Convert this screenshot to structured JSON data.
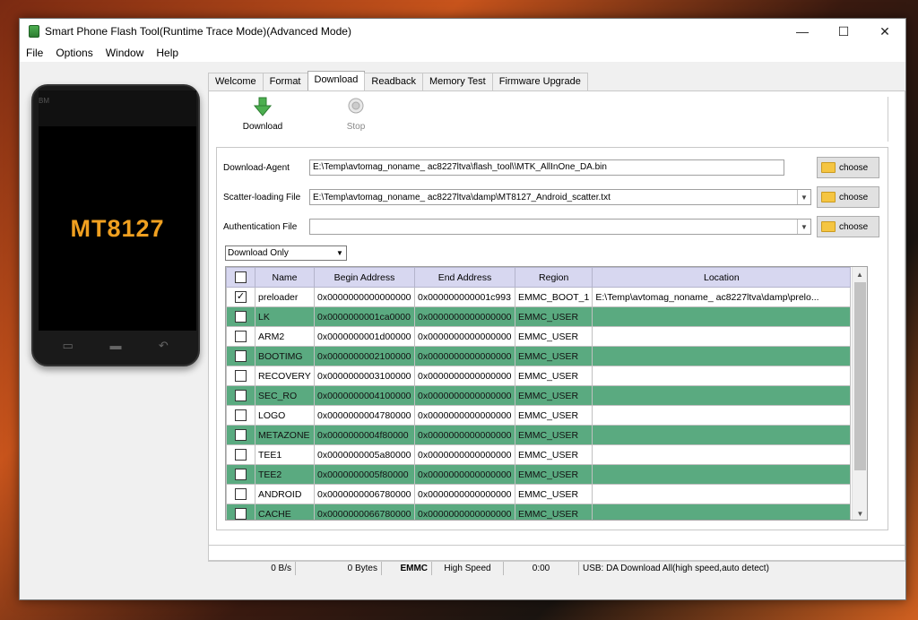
{
  "window": {
    "title": "Smart Phone Flash Tool(Runtime Trace Mode)(Advanced Mode)"
  },
  "menu": [
    "File",
    "Options",
    "Window",
    "Help"
  ],
  "phone": {
    "brand": "BM",
    "chip": "MT8127"
  },
  "tabs": [
    "Welcome",
    "Format",
    "Download",
    "Readback",
    "Memory Test",
    "Firmware Upgrade"
  ],
  "active_tab": "Download",
  "toolbar": {
    "download_label": "Download",
    "stop_label": "Stop"
  },
  "fields": {
    "download_agent": {
      "label": "Download-Agent",
      "value": "E:\\Temp\\avtomag_noname_ ac8227ltva\\flash_tool\\\\MTK_AllInOne_DA.bin"
    },
    "scatter_file": {
      "label": "Scatter-loading File",
      "value": "E:\\Temp\\avtomag_noname_ ac8227ltva\\damp\\MT8127_Android_scatter.txt"
    },
    "auth_file": {
      "label": "Authentication File",
      "value": ""
    }
  },
  "choose_label": "choose",
  "mode": "Download Only",
  "table": {
    "columns": [
      "Name",
      "Begin Address",
      "End Address",
      "Region",
      "Location"
    ],
    "rows": [
      {
        "checked": true,
        "name": "preloader",
        "begin": "0x0000000000000000",
        "end": "0x000000000001c993",
        "region": "EMMC_BOOT_1",
        "location": "E:\\Temp\\avtomag_noname_ ac8227ltva\\damp\\prelo..."
      },
      {
        "checked": false,
        "name": "LK",
        "begin": "0x0000000001ca0000",
        "end": "0x0000000000000000",
        "region": "EMMC_USER",
        "location": ""
      },
      {
        "checked": false,
        "name": "ARM2",
        "begin": "0x0000000001d00000",
        "end": "0x0000000000000000",
        "region": "EMMC_USER",
        "location": ""
      },
      {
        "checked": false,
        "name": "BOOTIMG",
        "begin": "0x0000000002100000",
        "end": "0x0000000000000000",
        "region": "EMMC_USER",
        "location": ""
      },
      {
        "checked": false,
        "name": "RECOVERY",
        "begin": "0x0000000003100000",
        "end": "0x0000000000000000",
        "region": "EMMC_USER",
        "location": ""
      },
      {
        "checked": false,
        "name": "SEC_RO",
        "begin": "0x0000000004100000",
        "end": "0x0000000000000000",
        "region": "EMMC_USER",
        "location": ""
      },
      {
        "checked": false,
        "name": "LOGO",
        "begin": "0x0000000004780000",
        "end": "0x0000000000000000",
        "region": "EMMC_USER",
        "location": ""
      },
      {
        "checked": false,
        "name": "METAZONE",
        "begin": "0x0000000004f80000",
        "end": "0x0000000000000000",
        "region": "EMMC_USER",
        "location": ""
      },
      {
        "checked": false,
        "name": "TEE1",
        "begin": "0x0000000005a80000",
        "end": "0x0000000000000000",
        "region": "EMMC_USER",
        "location": ""
      },
      {
        "checked": false,
        "name": "TEE2",
        "begin": "0x0000000005f80000",
        "end": "0x0000000000000000",
        "region": "EMMC_USER",
        "location": ""
      },
      {
        "checked": false,
        "name": "ANDROID",
        "begin": "0x0000000006780000",
        "end": "0x0000000000000000",
        "region": "EMMC_USER",
        "location": ""
      },
      {
        "checked": false,
        "name": "CACHE",
        "begin": "0x0000000066780000",
        "end": "0x0000000000000000",
        "region": "EMMC_USER",
        "location": ""
      }
    ]
  },
  "status": {
    "speed": "0 B/s",
    "bytes": "0 Bytes",
    "storage": "EMMC",
    "mode": "High Speed",
    "time": "0:00",
    "usb": "USB: DA Download All(high speed,auto detect)"
  },
  "colors": {
    "row_highlight": "#5aaa80",
    "header_bg": "#d7d7f0",
    "chip_label": "#f0a020"
  }
}
